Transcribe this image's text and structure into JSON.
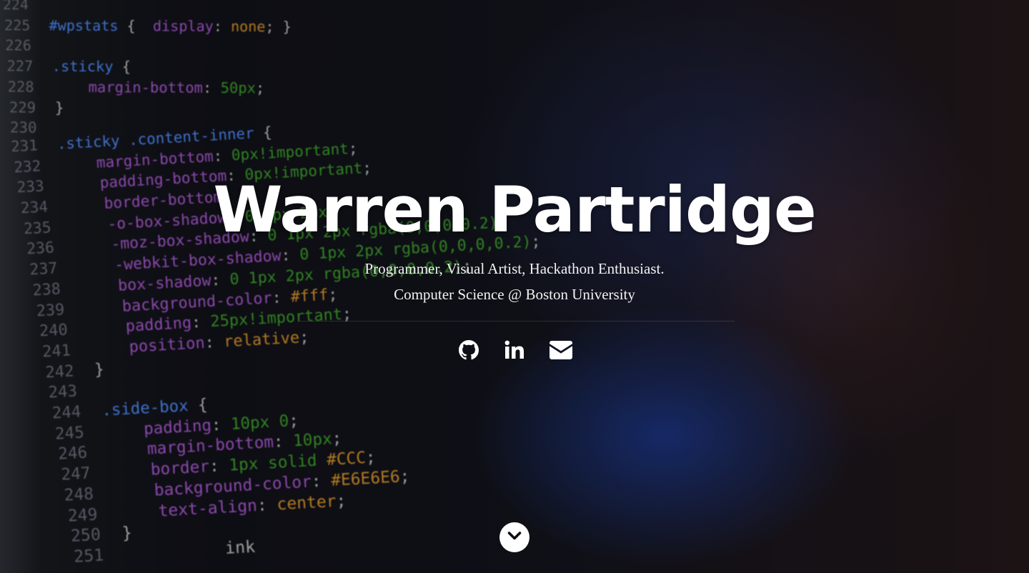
{
  "hero": {
    "title": "Warren Partridge",
    "subtitle_line1": "Programmer, Visual Artist, Hackathon Enthusiast.",
    "subtitle_line2": "Computer Science @ Boston University"
  },
  "social_links": [
    {
      "name": "github",
      "icon": "github-icon"
    },
    {
      "name": "linkedin",
      "icon": "linkedin-icon"
    },
    {
      "name": "email",
      "icon": "envelope-icon"
    }
  ],
  "scroll_button": {
    "icon": "chevron-down-icon"
  },
  "background": {
    "code_lines": [
      {
        "n": "224",
        "parts": []
      },
      {
        "n": "225",
        "parts": [
          [
            "sel",
            "#wpstats"
          ],
          [
            "pun",
            " {  "
          ],
          [
            "prop",
            "display"
          ],
          [
            "pun",
            ": "
          ],
          [
            "str",
            "none"
          ],
          [
            "pun",
            "; }"
          ]
        ]
      },
      {
        "n": "226",
        "parts": []
      },
      {
        "n": "227",
        "parts": [
          [
            "sel",
            ".sticky"
          ],
          [
            "pun",
            " {"
          ]
        ]
      },
      {
        "n": "228",
        "parts": [
          [
            "pun",
            "    "
          ],
          [
            "prop",
            "margin-bottom"
          ],
          [
            "pun",
            ": "
          ],
          [
            "val",
            "50px"
          ],
          [
            "pun",
            ";"
          ]
        ]
      },
      {
        "n": "229",
        "parts": [
          [
            "pun",
            "}"
          ]
        ]
      },
      {
        "n": "230",
        "parts": []
      },
      {
        "n": "231",
        "parts": [
          [
            "sel",
            ".sticky .content-inner"
          ],
          [
            "pun",
            " {"
          ]
        ]
      },
      {
        "n": "232",
        "parts": [
          [
            "pun",
            "    "
          ],
          [
            "prop",
            "margin-bottom"
          ],
          [
            "pun",
            ": "
          ],
          [
            "val",
            "0px!important"
          ],
          [
            "pun",
            ";"
          ]
        ]
      },
      {
        "n": "233",
        "parts": [
          [
            "pun",
            "    "
          ],
          [
            "prop",
            "padding-bottom"
          ],
          [
            "pun",
            ": "
          ],
          [
            "val",
            "0px!important"
          ],
          [
            "pun",
            ";"
          ]
        ]
      },
      {
        "n": "234",
        "parts": [
          [
            "pun",
            "    "
          ],
          [
            "prop",
            "border-bottom"
          ],
          [
            "pun",
            ": "
          ],
          [
            "val",
            "0"
          ],
          [
            "pun",
            ";"
          ]
        ]
      },
      {
        "n": "235",
        "parts": [
          [
            "pun",
            "    "
          ],
          [
            "prop",
            "-o-box-shadow"
          ],
          [
            "pun",
            ": "
          ],
          [
            "val",
            "0 1px 2px"
          ],
          [
            "pun",
            ";"
          ]
        ]
      },
      {
        "n": "236",
        "parts": [
          [
            "pun",
            "    "
          ],
          [
            "prop",
            "-moz-box-shadow"
          ],
          [
            "pun",
            ": "
          ],
          [
            "val",
            "0 1px 2px rgba(0,0,0,0.2)"
          ],
          [
            "pun",
            ";"
          ]
        ]
      },
      {
        "n": "237",
        "parts": [
          [
            "pun",
            "    "
          ],
          [
            "prop",
            "-webkit-box-shadow"
          ],
          [
            "pun",
            ": "
          ],
          [
            "val",
            "0 1px 2px rgba(0,0,0,0.2)"
          ],
          [
            "pun",
            ";"
          ]
        ]
      },
      {
        "n": "238",
        "parts": [
          [
            "pun",
            "    "
          ],
          [
            "prop",
            "box-shadow"
          ],
          [
            "pun",
            ": "
          ],
          [
            "val",
            "0 1px 2px rgba(0,0,0,0.2)"
          ],
          [
            "pun",
            ";"
          ]
        ]
      },
      {
        "n": "239",
        "parts": [
          [
            "pun",
            "    "
          ],
          [
            "prop",
            "background-color"
          ],
          [
            "pun",
            ": "
          ],
          [
            "str",
            "#fff"
          ],
          [
            "pun",
            ";"
          ]
        ]
      },
      {
        "n": "240",
        "parts": [
          [
            "pun",
            "    "
          ],
          [
            "prop",
            "padding"
          ],
          [
            "pun",
            ": "
          ],
          [
            "val",
            "25px!important"
          ],
          [
            "pun",
            ";"
          ]
        ]
      },
      {
        "n": "241",
        "parts": [
          [
            "pun",
            "    "
          ],
          [
            "prop",
            "position"
          ],
          [
            "pun",
            ": "
          ],
          [
            "str",
            "relative"
          ],
          [
            "pun",
            ";"
          ]
        ]
      },
      {
        "n": "242",
        "parts": [
          [
            "pun",
            "}"
          ]
        ]
      },
      {
        "n": "243",
        "parts": []
      },
      {
        "n": "244",
        "parts": [
          [
            "sel",
            ".side-box"
          ],
          [
            "pun",
            " {"
          ]
        ]
      },
      {
        "n": "245",
        "parts": [
          [
            "pun",
            "    "
          ],
          [
            "prop",
            "padding"
          ],
          [
            "pun",
            ": "
          ],
          [
            "val",
            "10px 0"
          ],
          [
            "pun",
            ";"
          ]
        ]
      },
      {
        "n": "246",
        "parts": [
          [
            "pun",
            "    "
          ],
          [
            "prop",
            "margin-bottom"
          ],
          [
            "pun",
            ": "
          ],
          [
            "val",
            "10px"
          ],
          [
            "pun",
            ";"
          ]
        ]
      },
      {
        "n": "247",
        "parts": [
          [
            "pun",
            "    "
          ],
          [
            "prop",
            "border"
          ],
          [
            "pun",
            ": "
          ],
          [
            "val",
            "1px solid "
          ],
          [
            "str",
            "#CCC"
          ],
          [
            "pun",
            ";"
          ]
        ]
      },
      {
        "n": "248",
        "parts": [
          [
            "pun",
            "    "
          ],
          [
            "prop",
            "background-color"
          ],
          [
            "pun",
            ": "
          ],
          [
            "str",
            "#E6E6E6"
          ],
          [
            "pun",
            ";"
          ]
        ]
      },
      {
        "n": "249",
        "parts": [
          [
            "pun",
            "    "
          ],
          [
            "prop",
            "text-align"
          ],
          [
            "pun",
            ": "
          ],
          [
            "str",
            "center"
          ],
          [
            "pun",
            ";"
          ]
        ]
      },
      {
        "n": "250",
        "parts": [
          [
            "pun",
            "}"
          ]
        ]
      },
      {
        "n": "251",
        "parts": [
          [
            "pun",
            "          "
          ],
          [
            "pun",
            "ink"
          ]
        ]
      }
    ]
  }
}
